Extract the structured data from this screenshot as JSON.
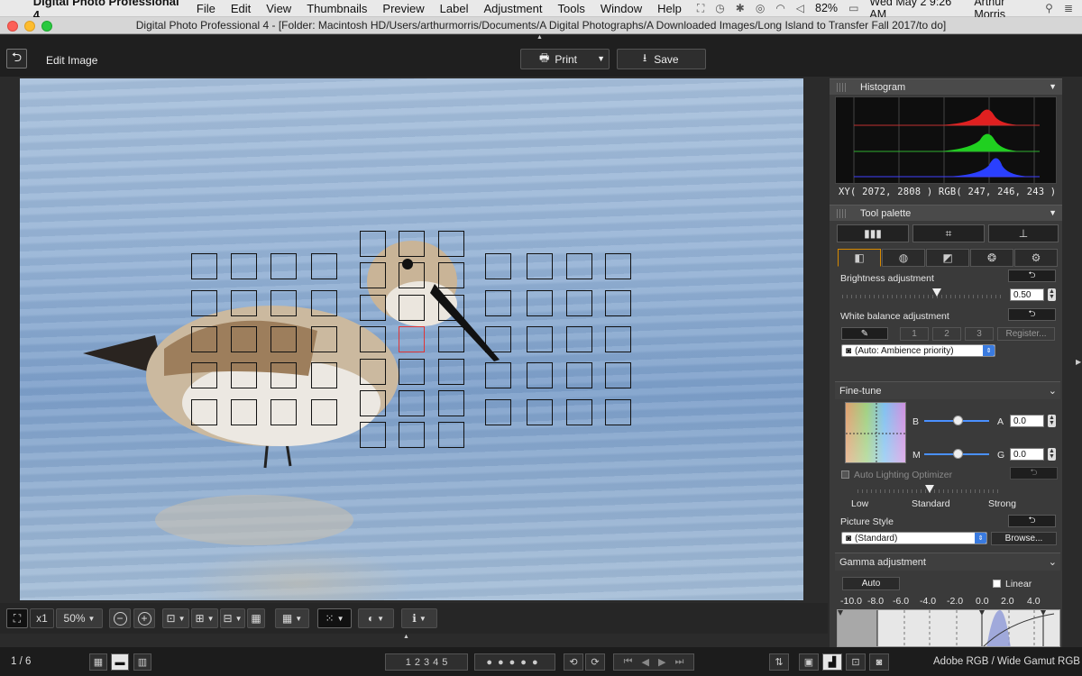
{
  "menubar": {
    "app_name": "Digital Photo Professional 4",
    "menus": [
      "File",
      "Edit",
      "View",
      "Thumbnails",
      "Preview",
      "Label",
      "Adjustment",
      "Tools",
      "Window",
      "Help"
    ],
    "battery": "82%",
    "datetime": "Wed May 2  9:26 AM",
    "user": "Arthur Morris"
  },
  "window": {
    "title": "Digital Photo Professional 4 - [Folder: Macintosh HD/Users/arthurmorris/Documents/A Digital Photographs/A Downloaded Images/Long Island to Transfer Fall 2017/to do]"
  },
  "toolbar": {
    "mode_label": "Edit Image",
    "print_label": "Print",
    "save_label": "Save"
  },
  "photo_tools": {
    "magnification": "x1",
    "zoom": "50%"
  },
  "status": {
    "page": "1 / 6",
    "color_space": "Adobe RGB / Wide Gamut RGB",
    "ratings": [
      "1",
      "2",
      "3",
      "4",
      "5"
    ]
  },
  "histogram": {
    "title": "Histogram",
    "xy_readout": "XY(  2072,   2808 ) RGB( 247,  246,  243 )"
  },
  "tool_palette": {
    "title": "Tool palette",
    "brightness_label": "Brightness adjustment",
    "brightness_value": "0.50",
    "wb_label": "White balance adjustment",
    "wb_presets": [
      "1",
      "2",
      "3"
    ],
    "register_label": "Register...",
    "wb_mode": "(Auto: Ambience priority)"
  },
  "fine_tune": {
    "title": "Fine-tune",
    "b_label": "B",
    "a_label": "A",
    "a_value": "0.0",
    "m_label": "M",
    "g_label": "G",
    "g_value": "0.0",
    "alo_label": "Auto Lighting Optimizer",
    "alo_levels": [
      "Low",
      "Standard",
      "Strong"
    ],
    "picture_style_label": "Picture Style",
    "picture_style_value": "(Standard)",
    "browse_label": "Browse..."
  },
  "gamma": {
    "title": "Gamma adjustment",
    "auto_label": "Auto",
    "linear_label": "Linear",
    "scale": [
      "-10.0",
      "-8.0",
      "-6.0",
      "-4.0",
      "-2.0",
      "0.0",
      "2.0",
      "4.0"
    ]
  },
  "colors": {
    "accent": "#d88a00",
    "af_active": "#e03535"
  }
}
